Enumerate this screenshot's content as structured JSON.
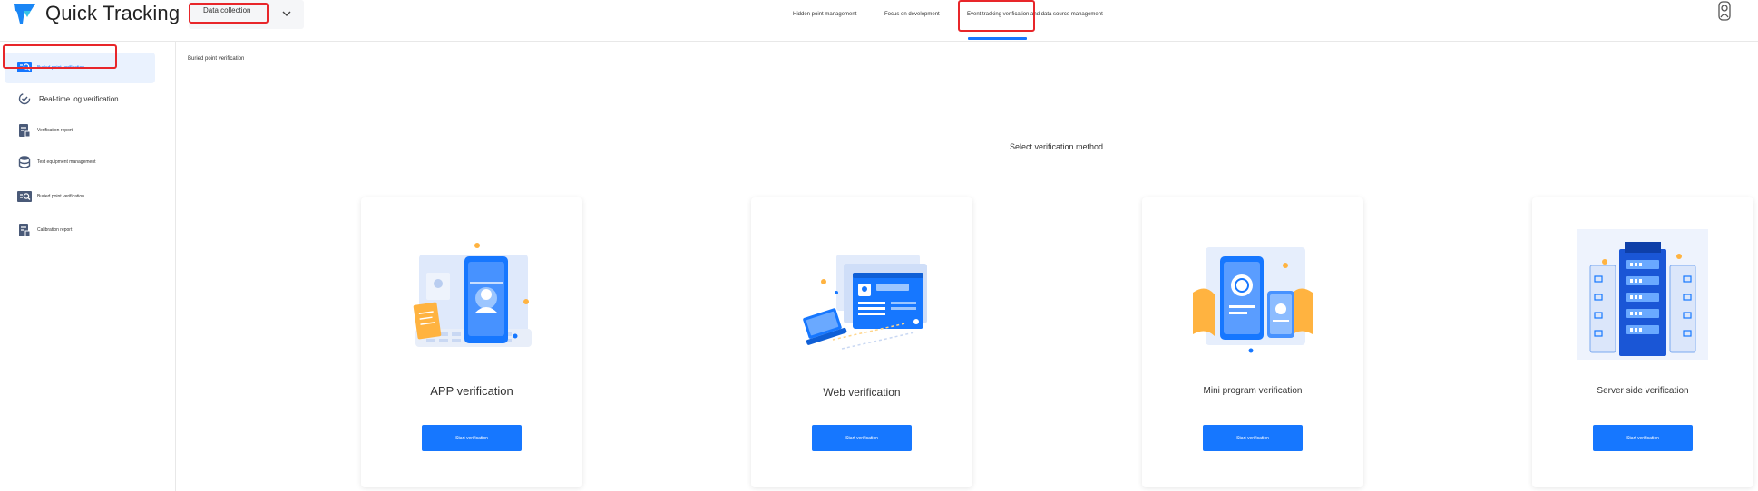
{
  "app": {
    "name": "Quick Tracking"
  },
  "app_selector": {
    "value": "Data collection"
  },
  "nav": {
    "tabs": [
      {
        "label": "Hidden point management"
      },
      {
        "label": "Focus on development"
      },
      {
        "label": "Event tracking verification and data source management"
      }
    ],
    "active_index": 2
  },
  "sidebar": {
    "items": [
      {
        "label": "Buried point verification",
        "icon": "scan-search-icon"
      },
      {
        "label": "Real-time log verification",
        "icon": "realtime-check-icon"
      },
      {
        "label": "Verification report",
        "icon": "report-icon"
      },
      {
        "label": "Test equipment management",
        "icon": "database-icon"
      },
      {
        "label": "Buried point verification",
        "icon": "scan-search-icon"
      },
      {
        "label": "Calibration report",
        "icon": "report-icon"
      }
    ]
  },
  "breadcrumb": {
    "text": "Buried point verification"
  },
  "main": {
    "section_title": "Select verification method",
    "cards": [
      {
        "title": "APP verification",
        "button": "Start verification",
        "illustration": "app-verification-illustration"
      },
      {
        "title": "Web verification",
        "button": "Start verification",
        "illustration": "web-verification-illustration"
      },
      {
        "title": "Mini program verification",
        "button": "Start verification",
        "illustration": "mini-program-illustration"
      },
      {
        "title": "Server side verification",
        "button": "Start verification",
        "illustration": "server-illustration"
      }
    ]
  },
  "colors": {
    "accent": "#1677ff",
    "highlight": "#e8262a",
    "active_bg": "#eaf2fe"
  }
}
